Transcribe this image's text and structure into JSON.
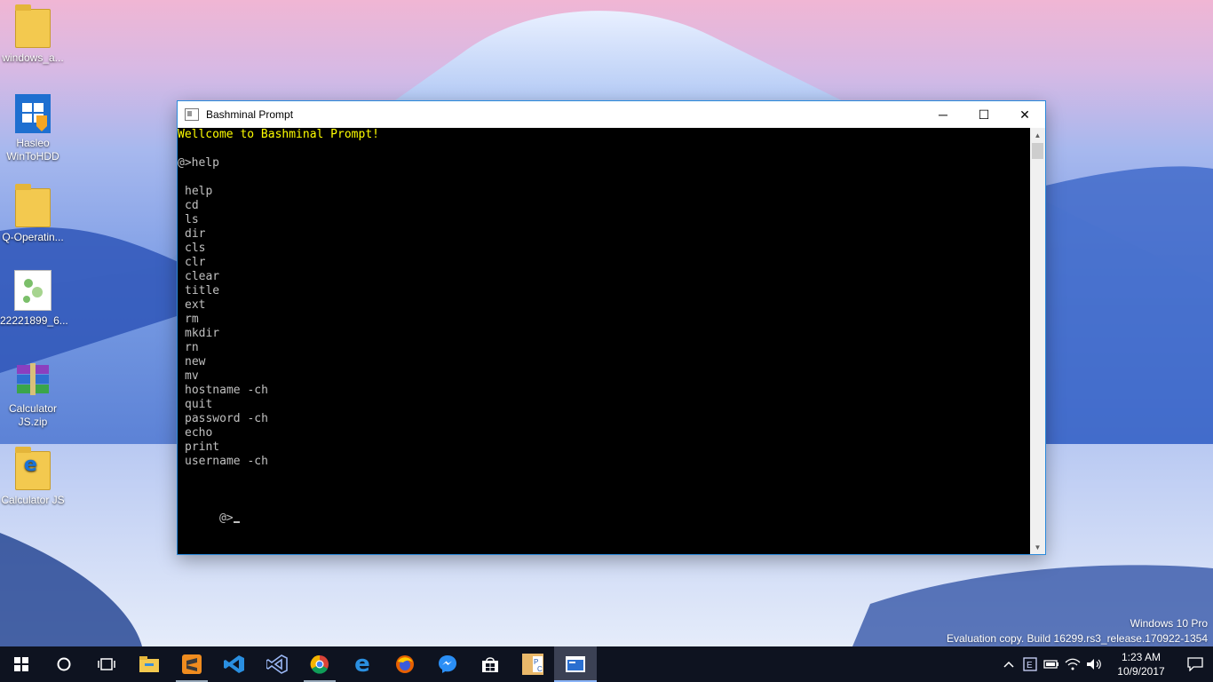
{
  "desktop": {
    "icons": [
      {
        "label": "windows_a...",
        "icon": "folder-icon"
      },
      {
        "label": "Hasleo WinToHDD",
        "icon": "wintohdd-app-icon"
      },
      {
        "label": "Q-Operatin...",
        "icon": "folder-icon"
      },
      {
        "label": "22221899_6...",
        "icon": "image-file-icon"
      },
      {
        "label": "Calculator JS.zip",
        "icon": "winrar-archive-icon"
      },
      {
        "label": "Calculator JS",
        "icon": "folder-icon"
      }
    ]
  },
  "window": {
    "title": "Bashminal Prompt",
    "controls": {
      "minimize": "─",
      "maximize": "☐",
      "close": "✕"
    }
  },
  "console": {
    "welcome": "Wellcome to Bashminal Prompt!",
    "first_prompt": "@>help",
    "commands": [
      "help",
      "cd",
      "ls",
      "dir",
      "cls",
      "clr",
      "clear",
      "title",
      "ext",
      "rm",
      "mkdir",
      "rn",
      "new",
      "mv",
      "hostname -ch",
      "quit",
      "password -ch",
      "echo",
      "print",
      "username -ch"
    ],
    "current_prompt": "@>"
  },
  "watermark": {
    "line1": "Windows 10 Pro",
    "line2": "Evaluation copy. Build 16299.rs3_release.170922-1354"
  },
  "taskbar": {
    "apps": [
      "start-icon",
      "cortana-search-icon",
      "task-view-icon",
      "file-explorer-icon",
      "sublime-text-icon",
      "vs-code-icon",
      "visual-studio-icon",
      "chrome-icon",
      "edge-icon",
      "firefox-icon",
      "messenger-icon",
      "store-icon",
      "pc-app-icon",
      "bashminal-prompt-icon"
    ],
    "clock_time": "1:23 AM",
    "clock_date": "10/9/2017"
  },
  "colors": {
    "console_bg": "#000000",
    "console_text": "#c0c0c0",
    "welcome_text": "#ffff00",
    "taskbar_bg": "#0e1320"
  }
}
